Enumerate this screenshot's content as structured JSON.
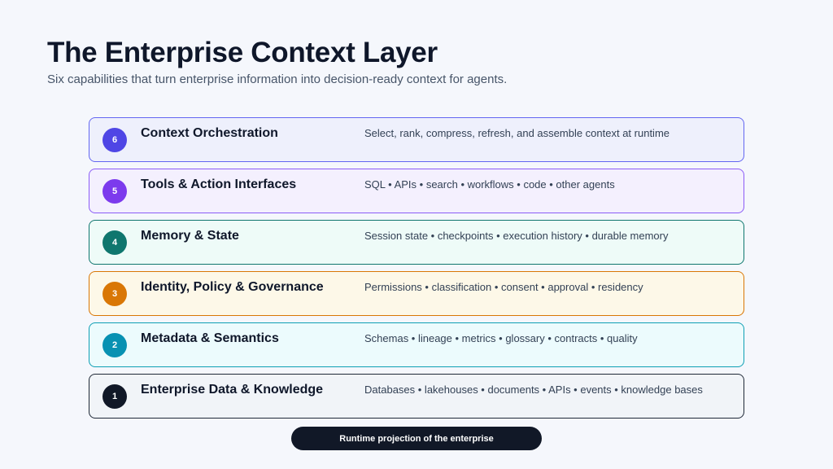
{
  "header": {
    "title": "The Enterprise Context Layer",
    "subtitle": "Six capabilities that turn enterprise information into decision-ready context for agents."
  },
  "layers": [
    {
      "number": "6",
      "name": "Context Orchestration",
      "description": "Select, rank, compress, refresh, and assemble context at runtime",
      "border_color": "#6366f1",
      "bg_color": "#eef0fc",
      "badge_color": "#4f46e5"
    },
    {
      "number": "5",
      "name": "Tools & Action Interfaces",
      "description": "SQL • APIs • search • workflows • code • other agents",
      "border_color": "#8b5cf6",
      "bg_color": "#f4f0fe",
      "badge_color": "#7c3aed"
    },
    {
      "number": "4",
      "name": "Memory & State",
      "description": "Session state • checkpoints • execution history • durable memory",
      "border_color": "#0f766e",
      "bg_color": "#eefbf8",
      "badge_color": "#0f766e"
    },
    {
      "number": "3",
      "name": "Identity, Policy & Governance",
      "description": "Permissions • classification • consent • approval • residency",
      "border_color": "#d97706",
      "bg_color": "#fdf8e8",
      "badge_color": "#d97706"
    },
    {
      "number": "2",
      "name": "Metadata & Semantics",
      "description": "Schemas • lineage • metrics • glossary • contracts • quality",
      "border_color": "#0e9fb4",
      "bg_color": "#ecfbfd",
      "badge_color": "#0891b2"
    },
    {
      "number": "1",
      "name": "Enterprise Data & Knowledge",
      "description": "Databases • lakehouses • documents • APIs • events • knowledge bases",
      "border_color": "#1f2937",
      "bg_color": "#f1f4f8",
      "badge_color": "#111827"
    }
  ],
  "footer": {
    "label": "Runtime projection of the enterprise"
  }
}
